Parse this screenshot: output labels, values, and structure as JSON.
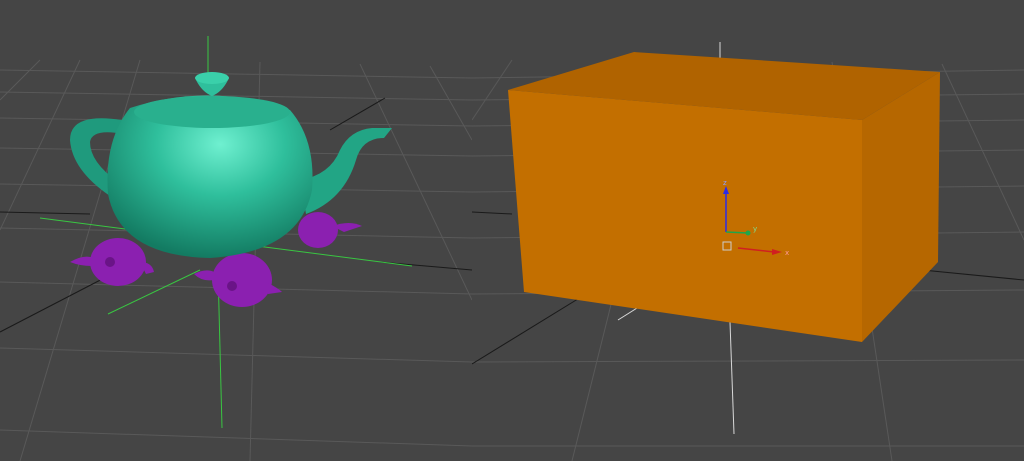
{
  "colors": {
    "viewport_background": "#454545",
    "grid": "#595959",
    "grid_dark": "#2f2f2f",
    "teapot": "#2fbf9c",
    "small_teapots": "#8b20b0",
    "box_front": "#c36f00",
    "box_top": "#b06300",
    "box_side": "#b66700",
    "pivot_green": "#39c642",
    "gizmo_x": "#d02020",
    "gizmo_y": "#1fa64a",
    "gizmo_z": "#2b2be8"
  },
  "viewports": {
    "left": {
      "scene_objects": [
        "teapot",
        "small-teapot",
        "small-teapot",
        "small-teapot"
      ]
    },
    "right": {
      "scene_objects": [
        "box"
      ]
    }
  },
  "gizmo": {
    "x_label": "x",
    "y_label": "y",
    "z_label": "z"
  }
}
